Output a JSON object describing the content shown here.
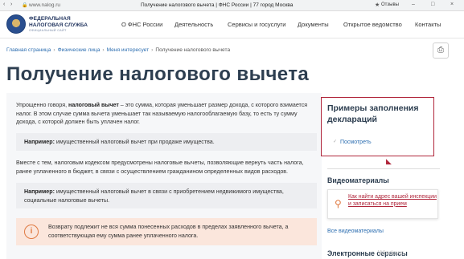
{
  "browser": {
    "url": "www.nalog.ru",
    "tab_title": "Получение налогового вычета | ФНС России | 77 город Москва",
    "reviews_label": "Отзывы"
  },
  "header": {
    "org_name": "ФЕДЕРАЛЬНАЯ НАЛОГОВАЯ СЛУЖБА",
    "org_sub": "ОФИЦИАЛЬНЫЙ САЙТ",
    "nav": [
      "О ФНС России",
      "Деятельность",
      "Сервисы и госуслуги",
      "Документы",
      "Открытое ведомство",
      "Контакты"
    ]
  },
  "breadcrumb": [
    "Главная страница",
    "Физические лица",
    "Меня интересует",
    "Получение налогового вычета"
  ],
  "page_title": "Получение налогового вычета",
  "main": {
    "p1_pre": "Упрощенно говоря, ",
    "p1_bold": "налоговый вычет",
    "p1_post": " – это сумма, которая уменьшает размер дохода, с которого взимается налог. В этом случае сумма вычета уменьшает так называемую налогооблагаемую базу, то есть ту сумму дохода, с которой должен быть уплачен налог.",
    "note1_bold": "Например:",
    "note1_text": " имущественный налоговый вычет при продаже имущества.",
    "p2": "Вместе с тем, налоговым кодексом предусмотрены налоговые вычеты, позволяющие вернуть часть налога, ранее уплаченного в бюджет, в связи с осуществлением гражданином определенных видов расходов.",
    "note2_bold": "Например:",
    "note2_text": " имущественный налоговый вычет в связи с приобретением недвижимого имущества, социальные налоговые вычеты.",
    "warning": "Возврату подлежит не вся сумма понесенных расходов в пределах заявленного вычета, а соответствующая ему сумма ранее уплаченного налога."
  },
  "sidebar": {
    "samples_title": "Примеры заполнения деклараций",
    "samples_link": "Посмотреть",
    "video_heading": "Видеоматериалы",
    "video_link": "Как найти адрес вашей инспекции и записаться на прием",
    "all_videos": "Все видеоматериалы",
    "e_services": "Электронные сервисы",
    "watermark": "Windows"
  },
  "colors": {
    "accent_red": "#b0263b",
    "link_blue": "#2b6db0",
    "warning_orange": "#e07a42",
    "title_dark": "#2d3e50"
  }
}
